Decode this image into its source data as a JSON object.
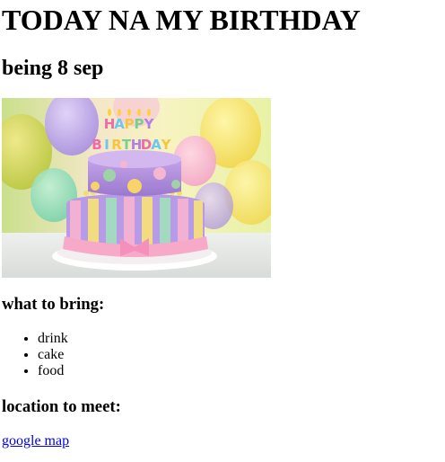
{
  "title": "TODAY NA MY BIRTHDAY",
  "subtitle": "being 8 sep",
  "image": {
    "alt": "",
    "candle_letters": [
      "H",
      "A",
      "P",
      "P",
      "Y",
      "B",
      "I",
      "R",
      "T",
      "H",
      "D",
      "A",
      "Y"
    ]
  },
  "bring": {
    "heading": "what to bring:",
    "items": [
      "drink",
      "cake",
      "food"
    ]
  },
  "location": {
    "heading": "location to meet:",
    "link_text": "google map"
  },
  "colors": {
    "link": "#0000ee",
    "text": "#000000"
  }
}
